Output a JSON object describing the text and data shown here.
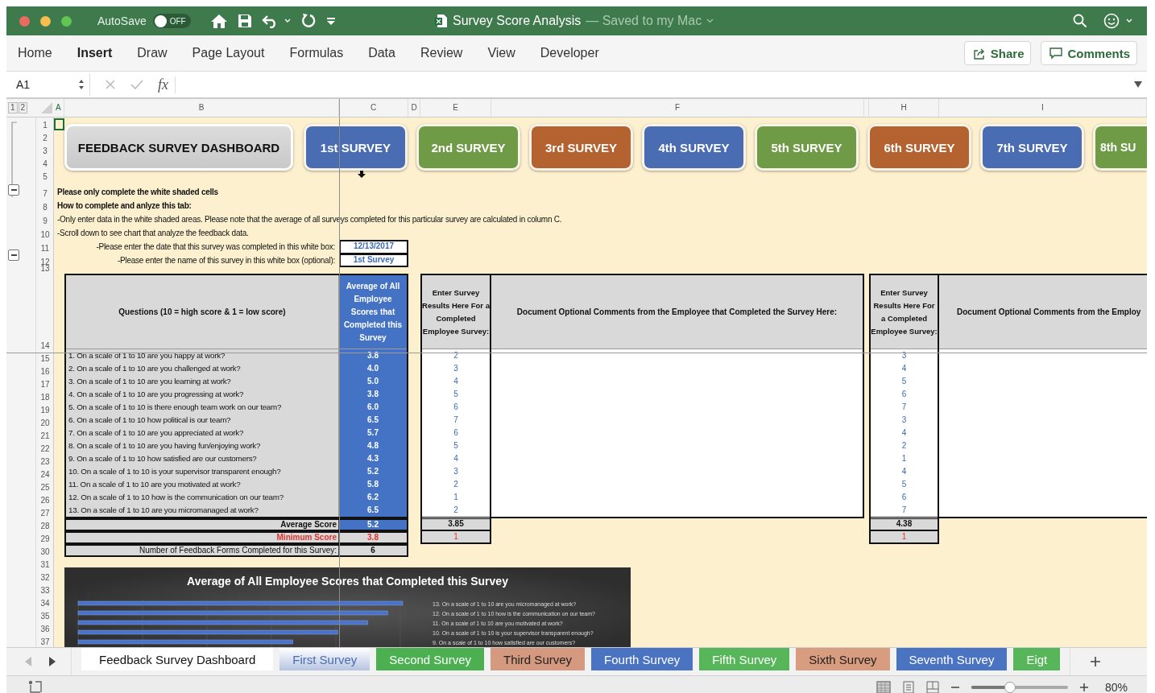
{
  "window": {
    "title": "Survey Score Analysis",
    "save_status": "— Saved to my Mac",
    "autosave": {
      "label": "AutoSave",
      "on": false,
      "state_text": "OFF"
    }
  },
  "ribbon_tabs": [
    {
      "label": "Home",
      "selected": false
    },
    {
      "label": "Insert",
      "selected": true
    },
    {
      "label": "Draw",
      "selected": false
    },
    {
      "label": "Page Layout",
      "selected": false
    },
    {
      "label": "Formulas",
      "selected": false
    },
    {
      "label": "Data",
      "selected": false
    },
    {
      "label": "Review",
      "selected": false
    },
    {
      "label": "View",
      "selected": false
    },
    {
      "label": "Developer",
      "selected": false
    }
  ],
  "ribbon_buttons": [
    "Share",
    "Comments"
  ],
  "formula_bar": {
    "name_box": "A1",
    "function_label": "fx"
  },
  "sheet": {
    "outline_levels": [
      "1",
      "2"
    ],
    "columns": [
      "A",
      "B",
      "C",
      "D",
      "E",
      "F",
      "H",
      "I"
    ],
    "row_numbers": [
      "1",
      "2",
      "3",
      "4",
      "5",
      "7",
      "8",
      "9",
      "10",
      "11",
      "12",
      "13",
      "14",
      "15",
      "16",
      "17",
      "18",
      "19",
      "20",
      "21",
      "22",
      "23",
      "24",
      "25",
      "26",
      "27",
      "28",
      "29",
      "30",
      "31",
      "32",
      "33",
      "34",
      "35",
      "36",
      "37"
    ],
    "dashboard_button": "FEEDBACK SURVEY DASHBOARD",
    "survey_buttons": [
      {
        "label": "1st SURVEY",
        "color": "#4a6cb3"
      },
      {
        "label": "2nd SURVEY",
        "color": "#6f9a46"
      },
      {
        "label": "3rd SURVEY",
        "color": "#b4622f"
      },
      {
        "label": "4th SURVEY",
        "color": "#4a6cb3"
      },
      {
        "label": "5th SURVEY",
        "color": "#6f9a46"
      },
      {
        "label": "6th SURVEY",
        "color": "#b4622f"
      },
      {
        "label": "7th SURVEY",
        "color": "#4a6cb3"
      },
      {
        "label": "8th SU",
        "color": "#6f9a46"
      }
    ],
    "instructions": [
      {
        "text": "Please only complete the white shaded cells",
        "bold": true
      },
      {
        "text": "How to complete and anlyze this tab:",
        "bold": true
      },
      {
        "text": "-Only enter data in the white shaded areas. Please note that the average of all surveys completed for this particular survey are calculated in column C.",
        "bold": false
      },
      {
        "text": "-Scroll down to see chart that analyze the feedback data.",
        "bold": false
      }
    ],
    "inputs": [
      {
        "prompt": "-Please enter the date that this survey was completed in this white box:",
        "value": "12/13/2017"
      },
      {
        "prompt": "-Please enter the name of this survey in this white box (optional):",
        "value": "1st Survey"
      }
    ],
    "questions_header": "Questions (10 = high score & 1 = low score)",
    "average_header": "Average of All Employee Scores that Completed this Survey",
    "questions": [
      {
        "text": "1. On a scale of 1 to 10 are you happy at work?",
        "average": "3.8"
      },
      {
        "text": "2. On a scale of 1 to 10 are you challenged at work?",
        "average": "4.0"
      },
      {
        "text": "3. On a scale of 1 to 10 are you learning at work?",
        "average": "5.0"
      },
      {
        "text": "4. On a scale of 1 to 10 are you progressing at work?",
        "average": "3.8"
      },
      {
        "text": "5. On a scale of 1 to 10 is there enough team work on our team?",
        "average": "6.0"
      },
      {
        "text": "6. On a scale of 1 to 10 how political is our team?",
        "average": "6.5"
      },
      {
        "text": "7. On a scale of 1 to 10 are you appreciated at work?",
        "average": "5.7"
      },
      {
        "text": "8. On a scale of 1 to 10 are you having fun/enjoying work?",
        "average": "4.8"
      },
      {
        "text": "9. On a scale of 1 to 10 how satisfied are our customers?",
        "average": "4.3"
      },
      {
        "text": "10. On a scale of 1 to 10 is your supervisor transparent enough?",
        "average": "5.2"
      },
      {
        "text": "11. On a scale of 1 to 10 are you motivated at work?",
        "average": "5.8"
      },
      {
        "text": "12. On a scale of 1 to 10 how is the communication on our team?",
        "average": "6.2"
      },
      {
        "text": "13. On a scale of 1 to 10 are you micromanaged at work?",
        "average": "6.5"
      }
    ],
    "summary": {
      "average_label": "Average Score",
      "average": "5.2",
      "minimum_label": "Minimum Score",
      "minimum": "3.8",
      "count_label": "Number of Feedback Forms Completed for this Survey:",
      "count": "6"
    },
    "responses": [
      {
        "header": "Enter Survey Results Here For a Completed Employee Survey:",
        "comments_header": "Document Optional Comments from the Employee that Completed the Survey Here:",
        "scores": [
          "2",
          "3",
          "4",
          "5",
          "6",
          "7",
          "6",
          "5",
          "4",
          "3",
          "2",
          "1",
          "2"
        ],
        "average": "3.85",
        "minimum": "1"
      },
      {
        "header": "Enter Survey Results Here For a Completed Employee Survey:",
        "comments_header": "Document Optional Comments from the Employ",
        "scores": [
          "3",
          "4",
          "5",
          "6",
          "7",
          "3",
          "4",
          "2",
          "1",
          "4",
          "5",
          "6",
          "7"
        ],
        "average": "4.38",
        "minimum": "1"
      }
    ],
    "chart": {
      "title": "Average of All Employee Scores that Completed this Survey",
      "labels": [
        "13. On a scale of 1 to 10 are you micromanaged at work?",
        "12. On a scale of 1 to 10 how is the communication on our team?",
        "11. On a scale of 1 to 10 are you motivated at work?",
        "10. On a scale of 1 to 10 is your supervisor transparent enough?",
        "9.   On a scale of 1 to 10 how satisfied are our customers?"
      ]
    }
  },
  "sheet_tabs": [
    {
      "label": "Feedback Survey Dashboard",
      "selected": false
    },
    {
      "label": "First Survey",
      "color": "#4a6cb3",
      "selected": true
    },
    {
      "label": "Second Survey",
      "color": "#4caf50",
      "selected": false
    },
    {
      "label": "Third Survey",
      "color": "#d4997e",
      "selected": false
    },
    {
      "label": "Fourth Survey",
      "color": "#4a73c2",
      "selected": false
    },
    {
      "label": "Fifth Survey",
      "color": "#57b65a",
      "selected": false
    },
    {
      "label": "Sixth Survey",
      "color": "#d89c7f",
      "selected": false
    },
    {
      "label": "Seventh Survey",
      "color": "#4a73c2",
      "selected": false
    },
    {
      "label": "Eigt",
      "color": "#57b65a",
      "selected": false
    }
  ],
  "status_bar": {
    "zoom": {
      "level": 0.4,
      "label": "80%"
    }
  }
}
